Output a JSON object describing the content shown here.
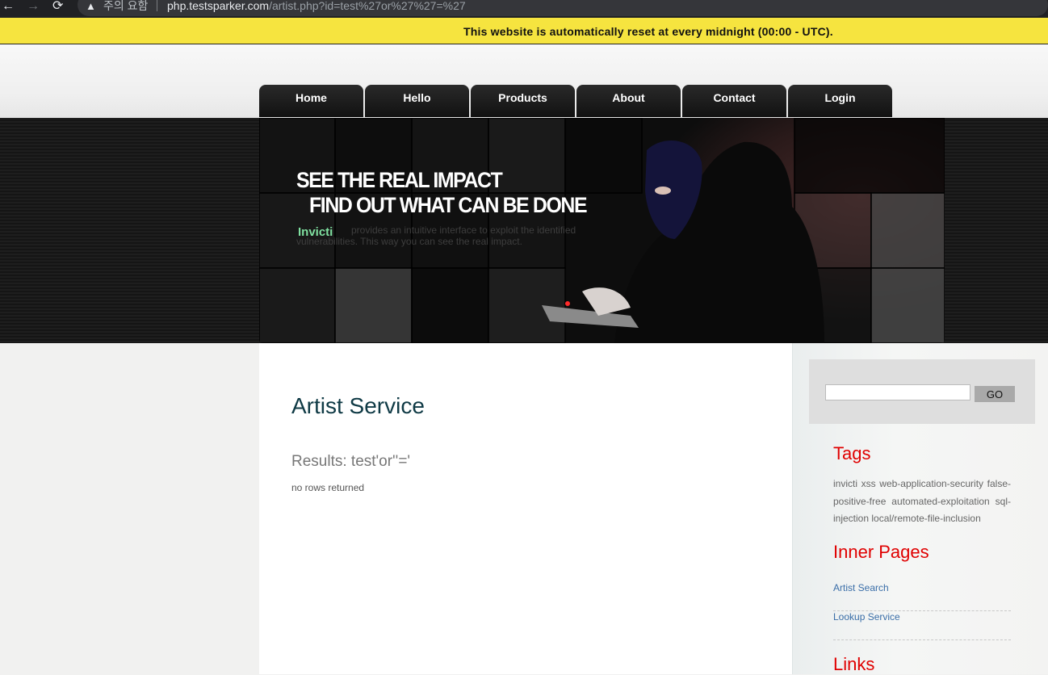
{
  "browser": {
    "warning_label": "주의 요함",
    "url_host": "php.testsparker.com",
    "url_path": "/artist.php?id=test%27or%27%27=%27",
    "back_icon": "←",
    "forward_icon": "→",
    "reload_icon": "⟳",
    "warning_icon": "▲"
  },
  "banner": {
    "text": "This website is automatically reset at every midnight (00:00 - UTC)."
  },
  "nav": {
    "items": [
      "Home",
      "Hello",
      "Products",
      "About",
      "Contact",
      "Login"
    ]
  },
  "hero": {
    "line1": "SEE THE REAL IMPACT",
    "line2": "FIND OUT WHAT CAN BE DONE",
    "brand": "Invicti",
    "text": "provides an intuitive interface to exploit the identified vulnerabilities. This way you can see the real impact."
  },
  "main": {
    "title": "Artist Service",
    "results": "Results: test'or''='",
    "message": "no rows returned"
  },
  "sidebar": {
    "search_value": "",
    "search_button": "GO",
    "tags_heading": "Tags",
    "tags": [
      "invicti",
      "xss",
      "web-application-security",
      "false-positive-free",
      "automated-exploitation",
      "sql-injection",
      "local/remote-file-inclusion"
    ],
    "inner_heading": "Inner Pages",
    "inner_links": [
      "Artist Search",
      "Lookup Service"
    ],
    "links_heading": "Links"
  },
  "colors": {
    "banner_bg": "#f6e43f",
    "heading_red": "#e00000",
    "title_teal": "#0f3a45",
    "link_blue": "#3a6ea8"
  }
}
